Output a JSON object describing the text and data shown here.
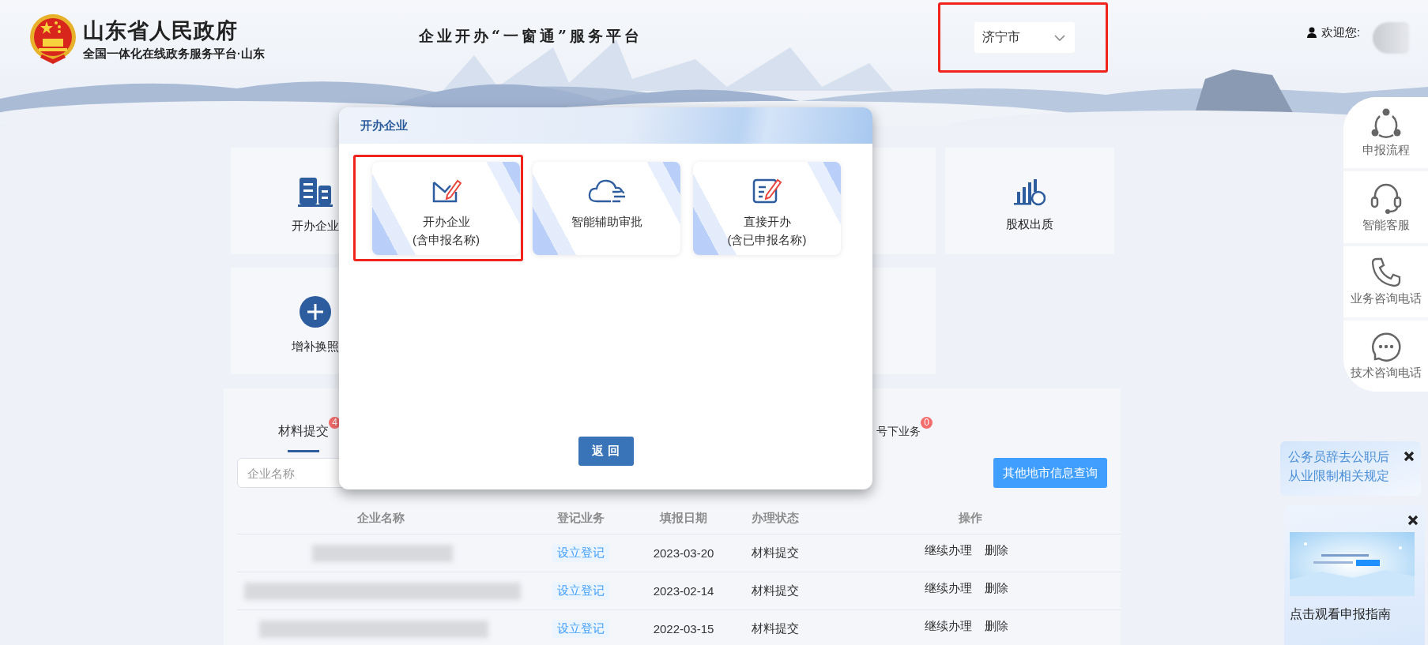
{
  "header": {
    "site_title": "山东省人民政府",
    "site_subtitle": "全国一体化在线政务服务平台·山东",
    "platform_title": "企业开办“一窗通”服务平台",
    "city_select": {
      "value": "济宁市",
      "highlighted": true
    },
    "welcome": "欢迎您:"
  },
  "tile_rows": [
    [
      {
        "kind": "tile",
        "label": "开办企业"
      },
      {
        "kind": "covered"
      },
      {
        "kind": "covered"
      },
      {
        "kind": "partial"
      },
      {
        "kind": "tile",
        "label": "股权出质"
      }
    ],
    [
      {
        "kind": "tile",
        "label": "增补换照"
      },
      {
        "kind": "covered"
      },
      {
        "kind": "covered"
      },
      {
        "kind": "partial"
      }
    ]
  ],
  "panel": {
    "tabs": [
      {
        "label": "材料提交",
        "badge": "4",
        "selected": true
      },
      {
        "label": "号下业务",
        "badge": "0",
        "selected": false
      }
    ],
    "search": {
      "placeholder": "企业名称"
    },
    "query_button": "其他地市信息查询",
    "table": {
      "columns": [
        "企业名称",
        "登记业务",
        "填报日期",
        "办理状态",
        "操作"
      ],
      "rows": [
        {
          "business": "设立登记",
          "date": "2023-03-20",
          "status": "材料提交",
          "actions": [
            "继续办理",
            "删除"
          ]
        },
        {
          "business": "设立登记",
          "date": "2023-02-14",
          "status": "材料提交",
          "actions": [
            "继续办理",
            "删除"
          ]
        },
        {
          "business": "设立登记",
          "date": "2022-03-15",
          "status": "材料提交",
          "actions": [
            "继续办理",
            "删除"
          ]
        }
      ]
    }
  },
  "modal": {
    "title": "开办企业",
    "options": [
      {
        "lines": [
          "开办企业",
          "(含申报名称)"
        ],
        "highlighted": true
      },
      {
        "lines": [
          "智能辅助审批"
        ],
        "highlighted": false
      },
      {
        "lines": [
          "直接开办",
          "(含已申报名称)"
        ],
        "highlighted": false
      }
    ],
    "back_button": "返 回"
  },
  "side_menu": [
    "申报流程",
    "智能客服",
    "业务咨询电话",
    "技术咨询电话"
  ],
  "notice": {
    "text": "公务员辞去公职后从业限制相关规定"
  },
  "video_card": {
    "caption": "点击观看申报指南"
  }
}
